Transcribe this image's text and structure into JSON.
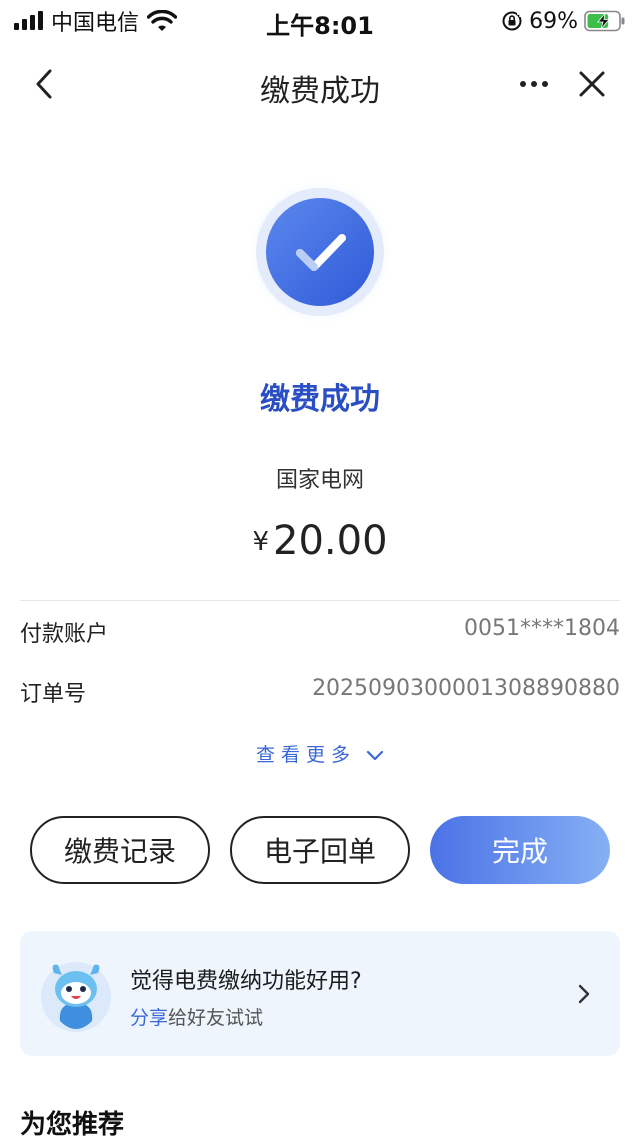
{
  "status_bar": {
    "carrier": "中国电信",
    "time": "上午8:01",
    "battery_percent": "69%",
    "battery_level": 0.69,
    "battery_charging": true
  },
  "nav": {
    "title": "缴费成功",
    "back_icon": "chevron-left-icon",
    "more_icon": "more-dots-icon",
    "close_icon": "close-icon"
  },
  "result": {
    "title": "缴费成功",
    "merchant": "国家电网",
    "currency": "¥",
    "amount": "20.00",
    "icon": "check-circle-icon"
  },
  "details": [
    {
      "label": "付款账户",
      "value": "0051****1804"
    },
    {
      "label": "订单号",
      "value": "2025090300001308890880"
    }
  ],
  "more_label": "查看更多",
  "buttons": {
    "records": "缴费记录",
    "receipt": "电子回单",
    "done": "完成"
  },
  "share_card": {
    "title": "觉得电费缴纳功能好用?",
    "sub_highlight": "分享",
    "sub_rest": "给好友试试"
  },
  "recommend_title": "为您推荐",
  "colors": {
    "primary": "#2a4fc4",
    "accent_blue": "#3a68d8",
    "button_gradient_start": "#4a72e6",
    "button_gradient_end": "#86b0f4",
    "card_bg": "#eef5fd"
  }
}
